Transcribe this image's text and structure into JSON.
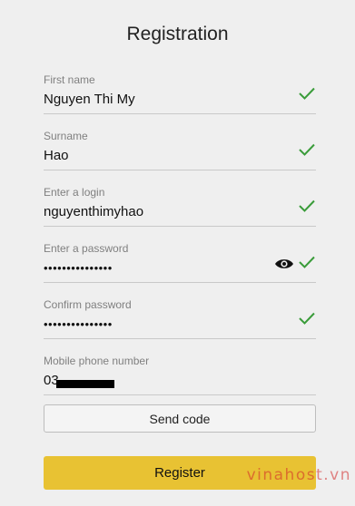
{
  "title": "Registration",
  "fields": [
    {
      "label": "First name",
      "value": "Nguyen Thi My",
      "valid": true
    },
    {
      "label": "Surname",
      "value": "Hao",
      "valid": true
    },
    {
      "label": "Enter a login",
      "value": "nguyenthimyhao",
      "valid": true
    },
    {
      "label": "Enter a password",
      "value": "•••••••••••••••",
      "valid": true,
      "show_password_icon": "eye-icon"
    },
    {
      "label": "Confirm password",
      "value": "•••••••••••••••",
      "valid": true
    },
    {
      "label": "Mobile phone number",
      "value": "03"
    }
  ],
  "buttons": {
    "send_code": "Send code",
    "register": "Register"
  },
  "watermark": "vinahost.vn",
  "colors": {
    "accent": "#e8c233",
    "check": "#3a9c3a"
  }
}
